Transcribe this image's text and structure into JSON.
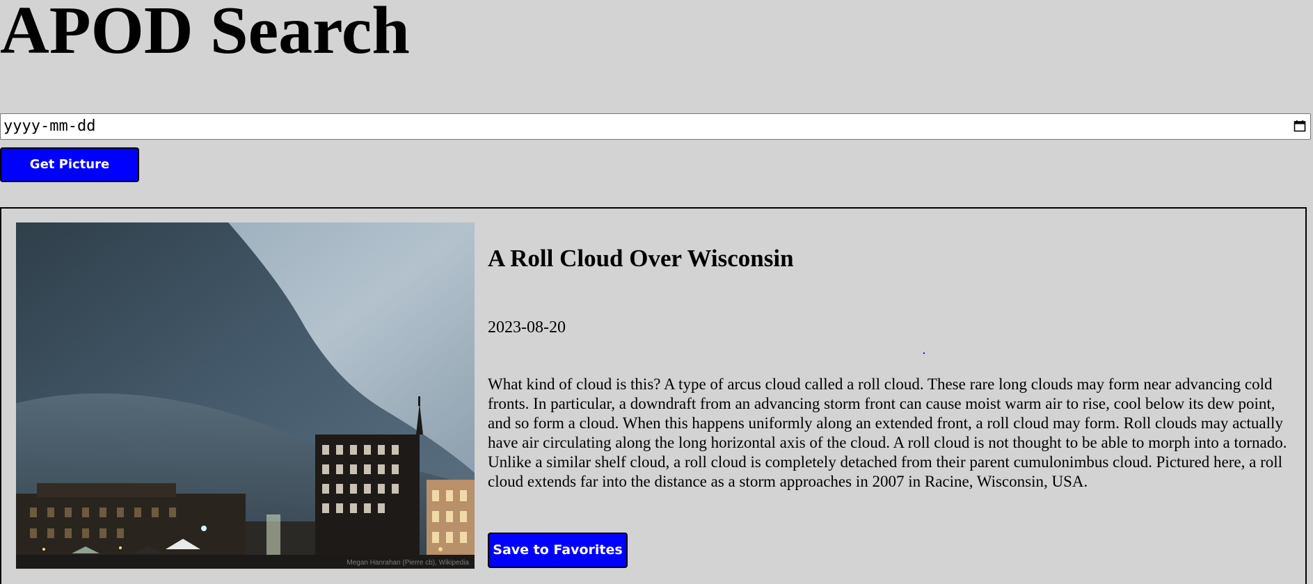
{
  "header": {
    "title": "APOD Search"
  },
  "search": {
    "date_placeholder": "yyyy-mm-dd",
    "calendar_icon": "calendar-icon",
    "button_label": "Get Picture"
  },
  "apod": {
    "title": "A Roll Cloud Over Wisconsin",
    "date": "2023-08-20",
    "explanation": "What kind of cloud is this? A type of arcus cloud called a roll cloud. These rare long clouds may form near advancing cold fronts. In particular, a downdraft from an advancing storm front can cause moist warm air to rise, cool below its dew point, and so form a cloud. When this happens uniformly along an extended front, a roll cloud may form. Roll clouds may actually have air circulating along the long horizontal axis of the cloud. A roll cloud is not thought to be able to morph into a tornado. Unlike a similar shelf cloud, a roll cloud is completely detached from their parent cumulonimbus cloud. Pictured here, a roll cloud extends far into the distance as a storm approaches in 2007 in Racine, Wisconsin, USA.",
    "image_credit": "Megan Hanrahan (Pierre cb), Wikipedia",
    "save_label": "Save to Favorites"
  },
  "colors": {
    "background": "#d3d3d3",
    "button": "#0000ff",
    "button_text": "#ffffff"
  }
}
